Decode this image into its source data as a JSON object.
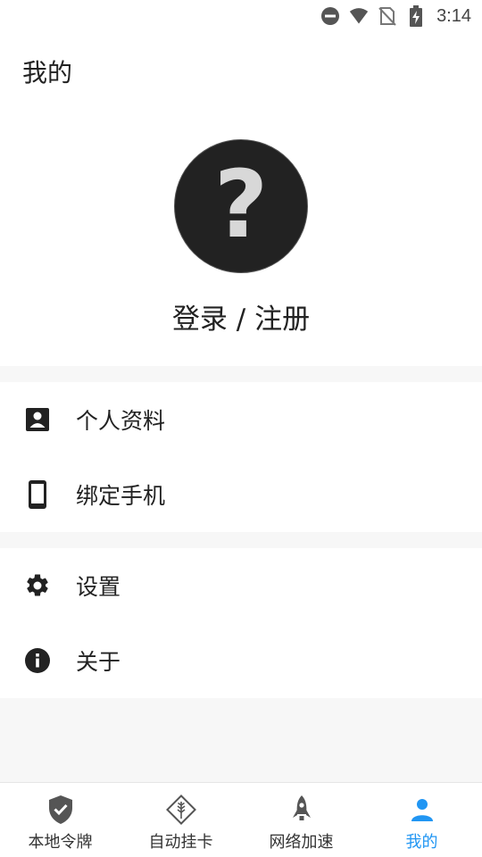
{
  "status_bar": {
    "time": "3:14",
    "icons": [
      "do-not-disturb-icon",
      "wifi-icon",
      "no-sim-icon",
      "battery-charging-icon"
    ]
  },
  "header": {
    "title": "我的",
    "avatar_icon": "question-mark-icon",
    "login_label": "登录 / 注册"
  },
  "menu": {
    "group1": [
      {
        "label": "个人资料",
        "icon": "profile-card-icon"
      },
      {
        "label": "绑定手机",
        "icon": "smartphone-icon"
      }
    ],
    "group2": [
      {
        "label": "设置",
        "icon": "gear-icon"
      },
      {
        "label": "关于",
        "icon": "info-icon"
      }
    ]
  },
  "tabbar": {
    "tabs": [
      {
        "label": "本地令牌",
        "icon": "shield-check-icon",
        "active": false
      },
      {
        "label": "自动挂卡",
        "icon": "wheat-diamond-icon",
        "active": false
      },
      {
        "label": "网络加速",
        "icon": "rocket-icon",
        "active": false
      },
      {
        "label": "我的",
        "icon": "person-icon",
        "active": true
      }
    ]
  },
  "colors": {
    "accent": "#2196f3",
    "icon_dark": "#222222",
    "icon_gray": "#555555",
    "background": "#f7f7f7"
  }
}
